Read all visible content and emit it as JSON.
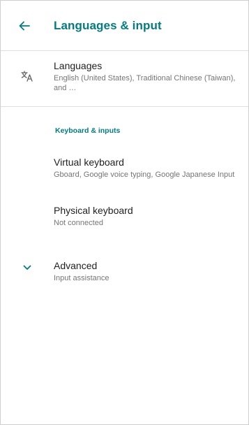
{
  "appbar": {
    "title": "Languages & input",
    "back_icon": "arrow-back-icon"
  },
  "languages": {
    "icon": "translate-icon",
    "title": "Languages",
    "summary": "English (United States), Traditional Chinese (Taiwan), and …"
  },
  "category": {
    "title": "Keyboard & inputs"
  },
  "virtual_keyboard": {
    "title": "Virtual keyboard",
    "summary": "Gboard, Google voice typing, Google Japanese Input"
  },
  "physical_keyboard": {
    "title": "Physical keyboard",
    "summary": "Not connected"
  },
  "advanced": {
    "icon": "chevron-down-icon",
    "title": "Advanced",
    "summary": "Input assistance"
  },
  "colors": {
    "accent": "#007d80",
    "title_text": "#212121",
    "summary_text": "#757575",
    "divider": "#dedede"
  }
}
